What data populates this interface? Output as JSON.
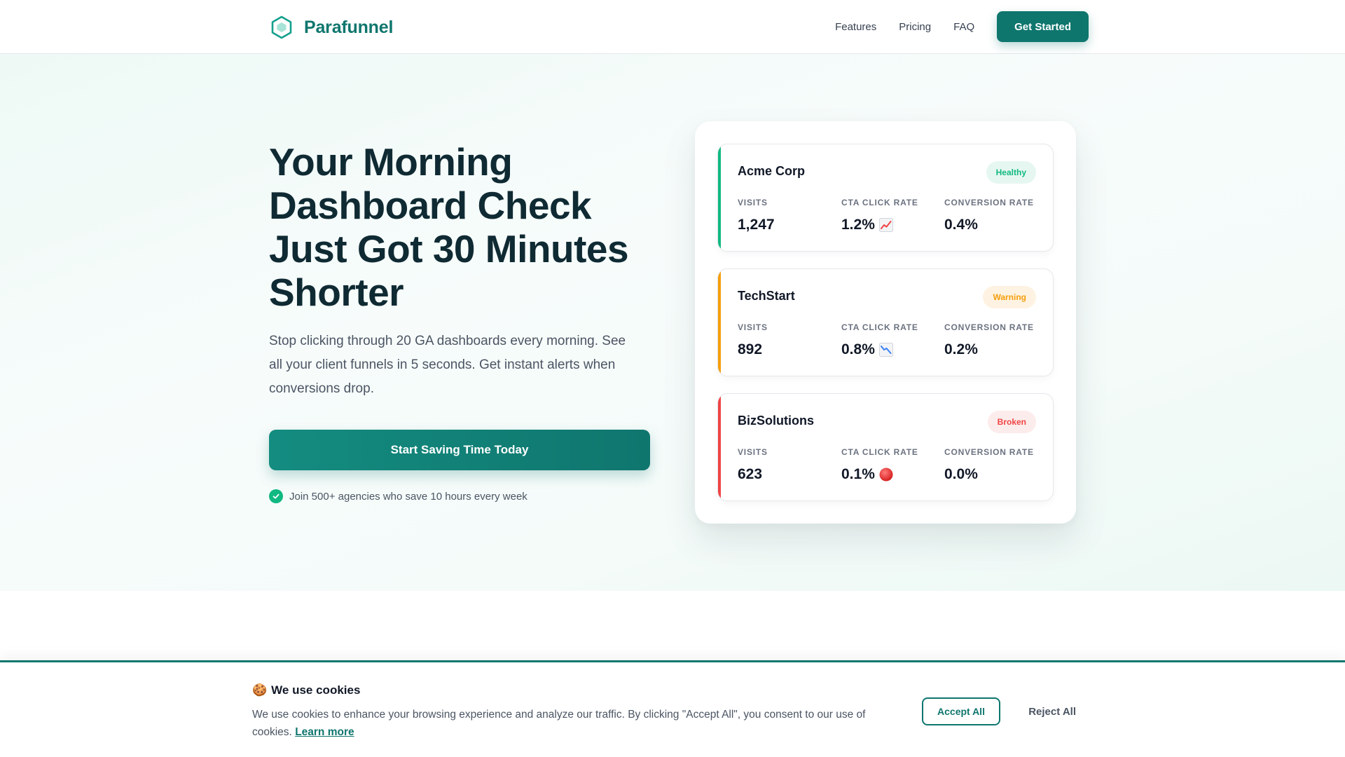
{
  "nav": {
    "brand": "Parafunnel",
    "links": [
      "Features",
      "Pricing",
      "FAQ"
    ],
    "cta": "Get Started"
  },
  "hero": {
    "title": "Your Morning Dashboard Check Just Got 30 Minutes Shorter",
    "subtitle": "Stop clicking through 20 GA dashboards every morning. See all your client funnels in 5 seconds. Get instant alerts when conversions drop.",
    "cta": "Start Saving Time Today",
    "trust": "Join 500+ agencies who save 10 hours every week"
  },
  "metric_labels": {
    "visits": "VISITS",
    "cta": "CTA CLICK RATE",
    "conversion": "CONVERSION RATE"
  },
  "clients": [
    {
      "name": "Acme Corp",
      "status": "Healthy",
      "visits": "1,247",
      "cta_rate": "1.2%",
      "cta_icon": "trending-up-icon",
      "conversion": "0.4%"
    },
    {
      "name": "TechStart",
      "status": "Warning",
      "visits": "892",
      "cta_rate": "0.8%",
      "cta_icon": "trending-down-icon",
      "conversion": "0.2%"
    },
    {
      "name": "BizSolutions",
      "status": "Broken",
      "visits": "623",
      "cta_rate": "0.1%",
      "cta_icon": "red-circle-icon",
      "conversion": "0.0%"
    }
  ],
  "colors": {
    "brand": "#0f766e",
    "healthy": "#10b981",
    "warning": "#f59e0b",
    "broken": "#ef4444"
  },
  "cookie": {
    "emoji": "🍪",
    "title": "We use cookies",
    "text": "We use cookies to enhance your browsing experience and analyze our traffic. By clicking \"Accept All\", you consent to our use of cookies.",
    "learn_more": "Learn more",
    "accept": "Accept All",
    "reject": "Reject All"
  }
}
